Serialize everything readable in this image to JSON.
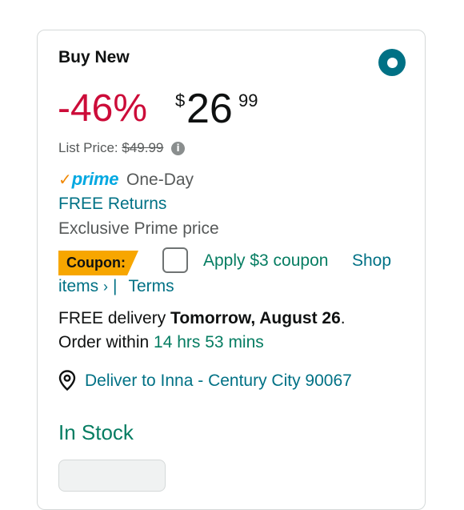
{
  "buy_box": {
    "heading": "Buy New",
    "discount": "-46%",
    "price": {
      "currency": "$",
      "whole": "26",
      "fraction": "99"
    },
    "list_price": {
      "label": "List Price:",
      "value": "$49.99"
    },
    "prime": {
      "check": "✓",
      "brand": "prime",
      "speed": "One-Day"
    },
    "free_returns": "FREE Returns",
    "exclusive": "Exclusive Prime price",
    "coupon": {
      "badge": "Coupon:",
      "apply": "Apply $3 coupon",
      "shop": "Shop",
      "items": "items",
      "chevron": "›",
      "separator": "|",
      "terms": "Terms"
    },
    "delivery": {
      "prefix": "FREE delivery",
      "date": "Tomorrow, August 26",
      "period": ".",
      "order_within": "Order within",
      "countdown": "14 hrs 53 mins"
    },
    "deliver_to": "Deliver to Inna - Century City 90067",
    "stock": "In Stock"
  },
  "colors": {
    "discount": "#cc0c39",
    "link": "#007185",
    "success": "#067d62",
    "coupon_badge": "#f7a600",
    "prime": "#00a8e1"
  },
  "icons": {
    "radio": "radio-selected-icon",
    "info": "info-icon",
    "location": "location-pin-icon"
  }
}
